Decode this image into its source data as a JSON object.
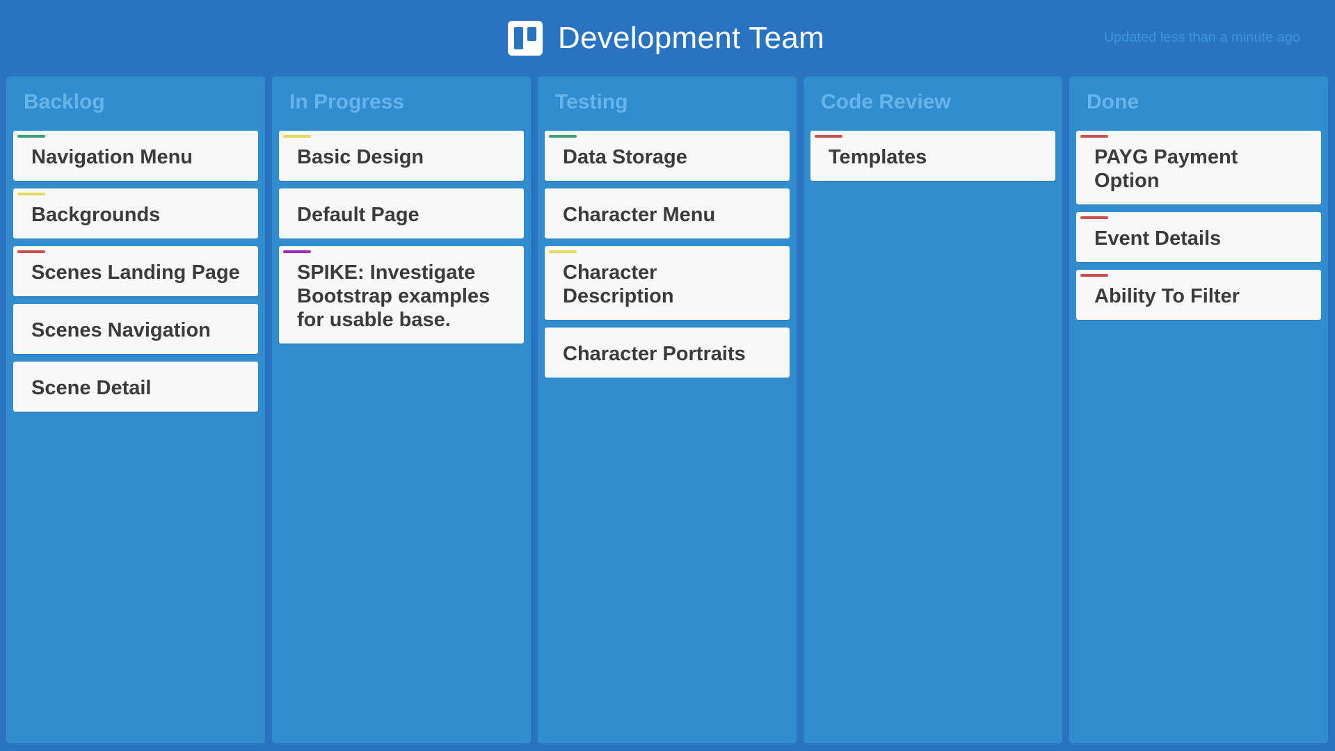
{
  "header": {
    "title": "Development Team",
    "updated": "Updated less than a minute ago",
    "logo_icon": "trello-icon"
  },
  "colors": {
    "background": "#2a73c0",
    "list": "#318dcd",
    "list_title": "#66b4ec",
    "card": "#f8f8f8",
    "label_green": "#3aa078",
    "label_yellow": "#e4da5c",
    "label_red": "#c9504f",
    "label_purple": "#9b2dbe"
  },
  "lists": [
    {
      "title": "Backlog",
      "cards": [
        {
          "title": "Navigation Menu",
          "label": "green"
        },
        {
          "title": "Backgrounds",
          "label": "yellow"
        },
        {
          "title": "Scenes Landing Page",
          "label": "red"
        },
        {
          "title": "Scenes Navigation",
          "label": ""
        },
        {
          "title": "Scene Detail",
          "label": ""
        }
      ]
    },
    {
      "title": "In Progress",
      "cards": [
        {
          "title": "Basic Design",
          "label": "yellow"
        },
        {
          "title": "Default Page",
          "label": ""
        },
        {
          "title": "SPIKE: Investigate Bootstrap examples for usable base.",
          "label": "purple"
        }
      ]
    },
    {
      "title": "Testing",
      "cards": [
        {
          "title": "Data Storage",
          "label": "green"
        },
        {
          "title": "Character Menu",
          "label": ""
        },
        {
          "title": "Character Description",
          "label": "yellow"
        },
        {
          "title": "Character Portraits",
          "label": ""
        }
      ]
    },
    {
      "title": "Code Review",
      "cards": [
        {
          "title": "Templates",
          "label": "red"
        }
      ]
    },
    {
      "title": "Done",
      "cards": [
        {
          "title": "PAYG Payment Option",
          "label": "red"
        },
        {
          "title": "Event Details",
          "label": "red"
        },
        {
          "title": "Ability To Filter",
          "label": "red"
        }
      ]
    }
  ]
}
